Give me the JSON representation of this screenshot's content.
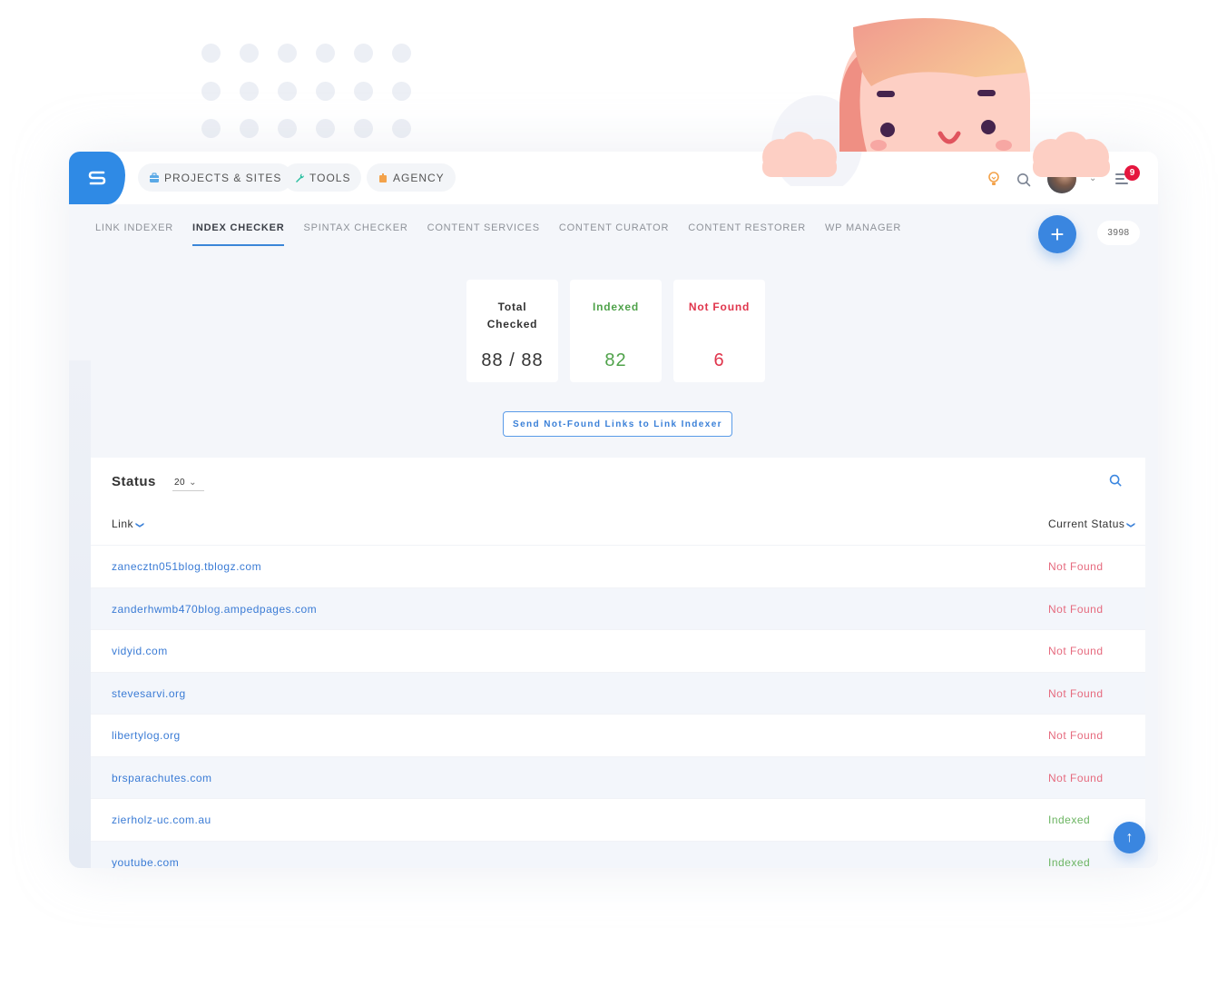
{
  "app": {
    "logo_letter": "S"
  },
  "topbar": {
    "pills": [
      {
        "label": "PROJECTS & SITES",
        "icon": "briefcase-icon",
        "color": "#5aa9e6"
      },
      {
        "label": "TOOLS",
        "icon": "wrench-icon",
        "color": "#2bbfa0"
      },
      {
        "label": "AGENCY",
        "icon": "building-icon",
        "color": "#f3a24a"
      }
    ],
    "notification_count": "9",
    "icons": [
      "lightbulb-icon",
      "search-icon",
      "avatar",
      "chevron-down-icon",
      "menu-icon"
    ]
  },
  "subnav": {
    "tabs": [
      {
        "label": "LINK INDEXER",
        "active": false
      },
      {
        "label": "INDEX CHECKER",
        "active": true
      },
      {
        "label": "SPINTAX CHECKER",
        "active": false
      },
      {
        "label": "CONTENT SERVICES",
        "active": false
      },
      {
        "label": "CONTENT CURATOR",
        "active": false
      },
      {
        "label": "CONTENT RESTORER",
        "active": false
      },
      {
        "label": "WP MANAGER",
        "active": false
      }
    ],
    "add_label": "+",
    "credits": "3998"
  },
  "stats": {
    "total": {
      "label_line1": "Total",
      "label_line2": "Checked",
      "value": "88 / 88"
    },
    "indexed": {
      "label": "Indexed",
      "value": "82"
    },
    "not_found": {
      "label": "Not Found",
      "value": "6"
    }
  },
  "actions": {
    "send_label": "Send Not-Found Links to Link Indexer"
  },
  "table": {
    "title": "Status",
    "per_page": "20",
    "columns": {
      "link": "Link",
      "status": "Current Status"
    },
    "rows": [
      {
        "link": "zanecztn051blog.tblogz.com",
        "status": "Not Found"
      },
      {
        "link": "zanderhwmb470blog.ampedpages.com",
        "status": "Not Found"
      },
      {
        "link": "vidyid.com",
        "status": "Not Found"
      },
      {
        "link": "stevesarvi.org",
        "status": "Not Found"
      },
      {
        "link": "libertylog.org",
        "status": "Not Found"
      },
      {
        "link": "brsparachutes.com",
        "status": "Not Found"
      },
      {
        "link": "zierholz-uc.com.au",
        "status": "Indexed"
      },
      {
        "link": "youtube.com",
        "status": "Indexed"
      }
    ]
  },
  "colors": {
    "accent": "#3a86e0",
    "indexed": "#4fa24a",
    "not_found": "#e0354c",
    "badge": "#e5163e"
  }
}
